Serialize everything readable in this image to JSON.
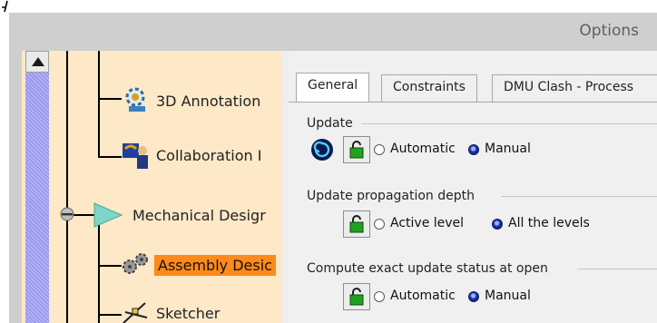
{
  "window": {
    "title": "Options"
  },
  "tree": {
    "items": [
      {
        "label": "3D Annotation",
        "icon": "3d-annotation-icon",
        "selected": false
      },
      {
        "label": "Collaboration I",
        "icon": "collaboration-icon",
        "selected": false
      },
      {
        "label": "Mechanical Desigr",
        "icon": "mechanical-design-icon",
        "selected": false
      },
      {
        "label": "Assembly Desic",
        "icon": "assembly-design-icon",
        "selected": true
      },
      {
        "label": "Sketcher",
        "icon": "sketcher-icon",
        "selected": false
      }
    ]
  },
  "tabs": [
    {
      "label": "General",
      "active": true
    },
    {
      "label": "Constraints",
      "active": false
    },
    {
      "label": "DMU Clash - Process",
      "active": false
    }
  ],
  "groups": {
    "update": {
      "label": "Update",
      "options": [
        {
          "label": "Automatic",
          "checked": false
        },
        {
          "label": "Manual",
          "checked": true
        }
      ]
    },
    "propagation": {
      "label": "Update propagation depth",
      "options": [
        {
          "label": "Active level",
          "checked": false
        },
        {
          "label": "All the levels",
          "checked": true
        }
      ]
    },
    "exact_status": {
      "label": "Compute exact update status at open",
      "options": [
        {
          "label": "Automatic",
          "checked": false
        },
        {
          "label": "Manual",
          "checked": true
        }
      ]
    }
  },
  "colors": {
    "selection": "#ff8a1a",
    "tree_bg": "#fde8c8",
    "scrollbar": "#9a99ee",
    "radio_on": "#1f3fbf"
  }
}
